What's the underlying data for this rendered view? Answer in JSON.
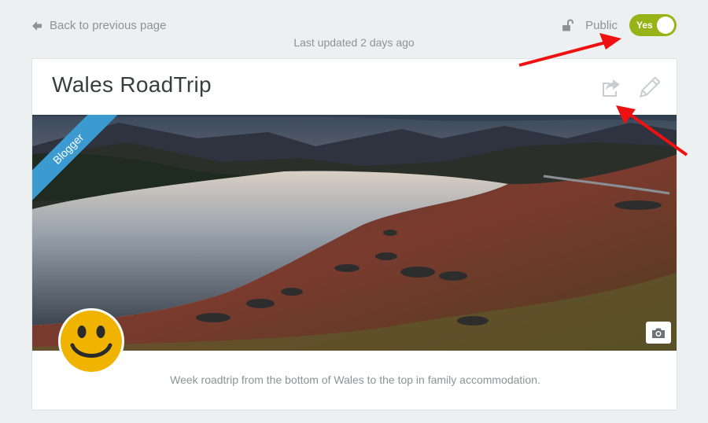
{
  "nav": {
    "back_label": "Back to previous page"
  },
  "meta": {
    "last_updated": "Last updated 2 days ago"
  },
  "visibility": {
    "label": "Public",
    "toggle_label": "Yes",
    "toggle_on": true
  },
  "card": {
    "title": "Wales RoadTrip",
    "ribbon": "Blogger",
    "description": "Week roadtrip from the bottom of Wales to the top in family accommodation."
  },
  "icons": {
    "back": "arrow-left-icon",
    "lock": "unlock-icon",
    "share": "share-icon",
    "edit": "pencil-icon",
    "camera": "camera-icon",
    "avatar": "smiley-face-icon"
  },
  "colors": {
    "toggle_on": "#97b317",
    "ribbon": "#3b9bd1",
    "annotation_arrow": "#ee1111",
    "avatar_face": "#f0b400"
  }
}
